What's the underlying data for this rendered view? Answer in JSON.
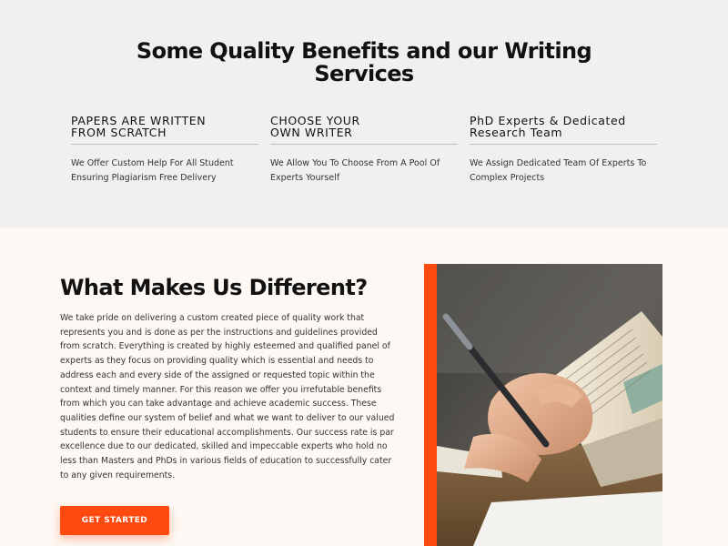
{
  "benefits": {
    "title_line1": "Some Quality Benefits and our Writing",
    "title_line2": "Services",
    "items": [
      {
        "heading_line1": "PAPERS ARE WRITTEN",
        "heading_line2": "FROM SCRATCH",
        "text_line1": "We Offer Custom Help For All Student",
        "text_line2": "Ensuring Plagiarism Free Delivery"
      },
      {
        "heading_line1": "CHOOSE YOUR",
        "heading_line2": "OWN WRITER",
        "text_line1": "We Allow You To Choose From A Pool Of",
        "text_line2": "Experts Yourself"
      },
      {
        "heading_line1": "PhD Experts & Dedicated",
        "heading_line2": "Research Team",
        "text_line1": "We Assign Dedicated Team Of Experts To",
        "text_line2": "Complex Projects"
      }
    ]
  },
  "different": {
    "title": "What Makes Us Different?",
    "body": "We take pride on delivering a custom created piece of quality work that represents you and is done as per the instructions and guidelines provided from scratch. Everything is created by highly esteemed and qualified panel of experts as they focus on providing quality which is essential and needs to address each and every side of the assigned or requested topic within the context and timely manner. For this reason we offer you irrefutable benefits from which you can take advantage and achieve academic success. These qualities define our system of belief and what we want to deliver to our valued students to ensure their educational accomplishments. Our success rate is par excellence due to our dedicated, skilled and impeccable experts who hold no less than Masters and PhDs in various fields of education to successfully cater to any given requirements.",
    "cta_label": "GET STARTED",
    "accent_color": "#ff4a0f"
  }
}
